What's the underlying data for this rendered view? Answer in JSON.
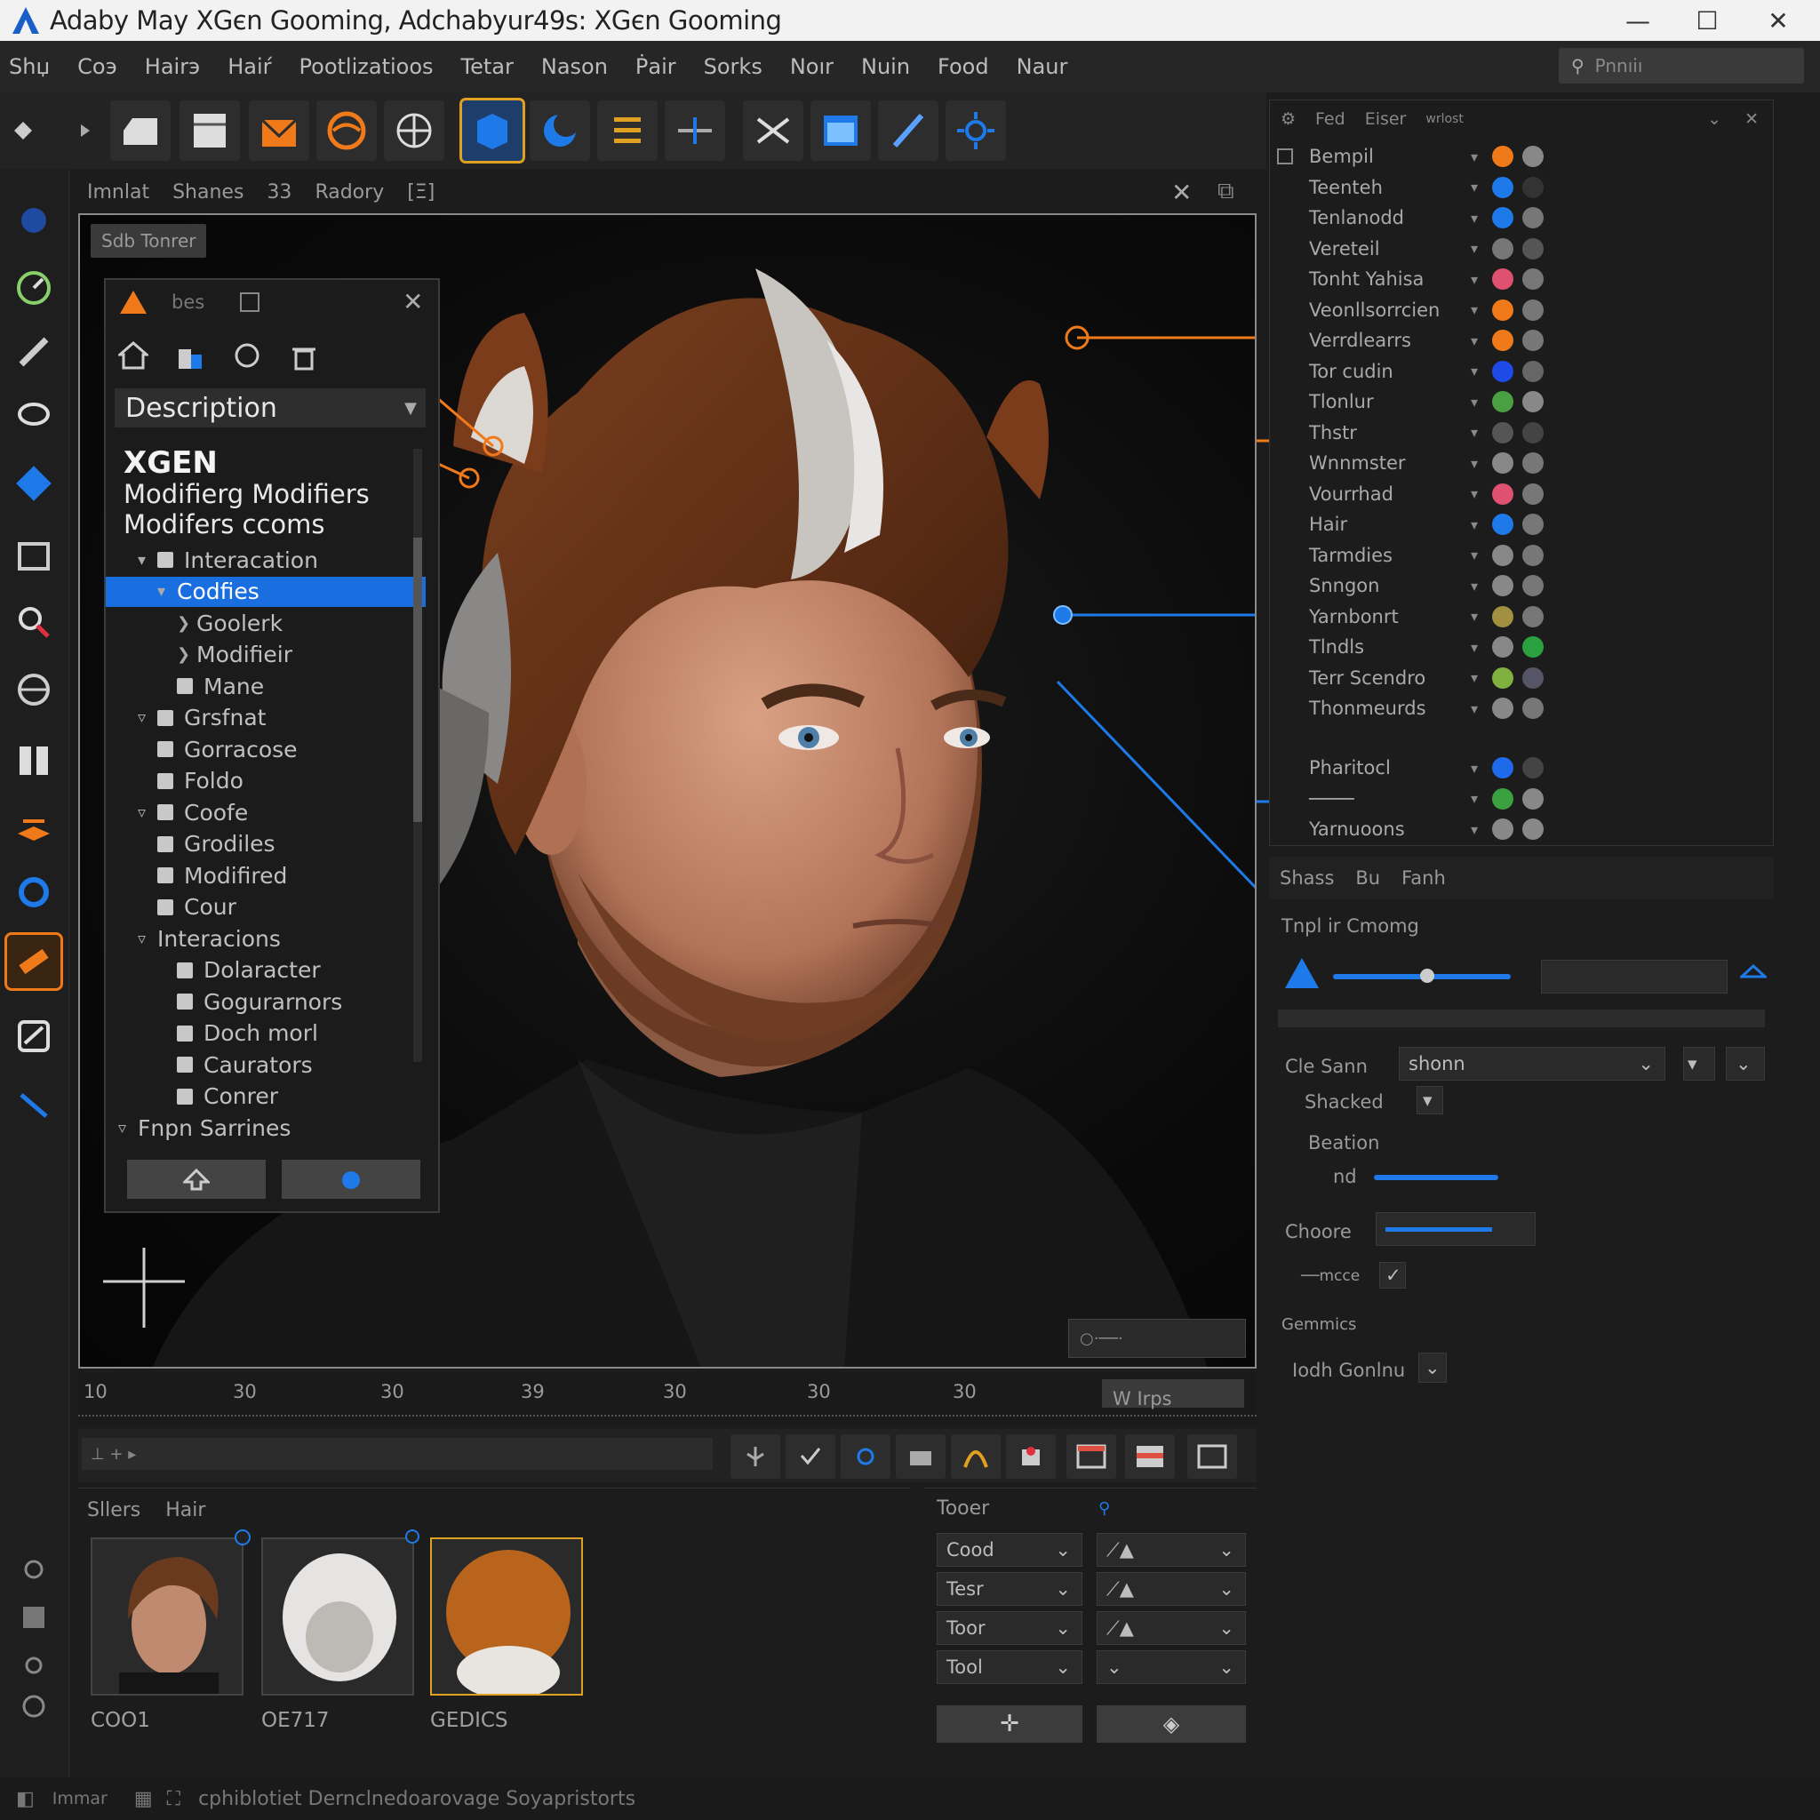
{
  "window": {
    "title": "Adaby May XGєn Goomіng, Adchabyur49s: XGєn Gooming",
    "minimize_glyph": "—",
    "maximize_glyph": "☐",
    "close_glyph": "✕"
  },
  "menu": [
    "Shџ",
    "Coэ",
    "Hairэ",
    "Haiŕ",
    "Pootlizatioos",
    "Tetar",
    "Nason",
    "Ṗair",
    "Sorks",
    "Noır",
    "Nuin",
    "Food",
    "Naur"
  ],
  "search": {
    "placeholder": "Pnnıı̇ı"
  },
  "viewport": {
    "tabs": [
      "Imnlat",
      "Shanes",
      "33",
      "Radory",
      "[Ξ]"
    ],
    "label": "Sdb Tonrer",
    "corner_value": "○·──·"
  },
  "desc_panel": {
    "header_text": "bes",
    "selector": "Description",
    "heading": "XGEN",
    "line1": "Modifierg  Modifiers",
    "line2": "Modifers ccoms",
    "tree": [
      {
        "label": "Interacation",
        "indent": 1,
        "arrow": "▾",
        "check": true
      },
      {
        "label": "Codfies",
        "indent": 2,
        "arrow": "▾",
        "check": false,
        "selected": true
      },
      {
        "label": "Goolerk",
        "indent": 3,
        "arrow": "❯",
        "check": false
      },
      {
        "label": "Modifieir",
        "indent": 3,
        "arrow": "❯",
        "check": false
      },
      {
        "label": "Mane",
        "indent": 2,
        "arrow": "",
        "check": true
      },
      {
        "label": "Grsfnat",
        "indent": 1,
        "arrow": "▿",
        "check": true
      },
      {
        "label": "Gorracose",
        "indent": 1,
        "arrow": "",
        "check": true
      },
      {
        "label": "Foldo",
        "indent": 1,
        "arrow": "",
        "check": true
      },
      {
        "label": "Coofe",
        "indent": 1,
        "arrow": "▿",
        "check": true
      },
      {
        "label": "Grodiles",
        "indent": 1,
        "arrow": "",
        "check": true
      },
      {
        "label": "Modifired",
        "indent": 1,
        "arrow": "",
        "check": true
      },
      {
        "label": "Cour",
        "indent": 1,
        "arrow": "",
        "check": true
      },
      {
        "label": "Interacions",
        "indent": 1,
        "arrow": "▿",
        "check": false
      },
      {
        "label": "Dolaracter",
        "indent": 2,
        "arrow": "",
        "check": true
      },
      {
        "label": "Gogurarnors",
        "indent": 2,
        "arrow": "",
        "check": true
      },
      {
        "label": "Doch morl",
        "indent": 2,
        "arrow": "",
        "check": true
      },
      {
        "label": "Caurators",
        "indent": 2,
        "arrow": "",
        "check": true
      },
      {
        "label": "Conrer",
        "indent": 2,
        "arrow": "",
        "check": true
      },
      {
        "label": "Fnpn Sarrines",
        "indent": 0,
        "arrow": "▿",
        "check": false
      }
    ]
  },
  "outliner": {
    "header": [
      "Fed",
      "Eiser",
      "wrlost"
    ],
    "rows": [
      {
        "name": "Bempil",
        "c1": "#f07a1a",
        "c2": "#888"
      },
      {
        "name": "Teenteh",
        "c1": "#1e7ae8",
        "c2": "#333"
      },
      {
        "name": "Tenlanodd",
        "c1": "#1e7ae8",
        "c2": "#777"
      },
      {
        "name": "Vereteil",
        "c1": "#777",
        "c2": "#555"
      },
      {
        "name": "Tonht Yahisa",
        "c1": "#e05070",
        "c2": "#777"
      },
      {
        "name": "Veonllsorrcien",
        "c1": "#f07a1a",
        "c2": "#777"
      },
      {
        "name": "Verrdlearrs",
        "c1": "#f07a1a",
        "c2": "#777"
      },
      {
        "name": "Tor cudin",
        "c1": "#1e4ae8",
        "c2": "#666"
      },
      {
        "name": "Tlonlur",
        "c1": "#4aa040",
        "c2": "#888"
      },
      {
        "name": "Thstr",
        "c1": "#555",
        "c2": "#444"
      },
      {
        "name": "Wnnmster",
        "c1": "#888",
        "c2": "#777"
      },
      {
        "name": "Vourrhad",
        "c1": "#e05070",
        "c2": "#777"
      },
      {
        "name": "Hair",
        "c1": "#1e7ae8",
        "c2": "#777"
      },
      {
        "name": "Tarmdies",
        "c1": "#888",
        "c2": "#777"
      },
      {
        "name": "Snngon",
        "c1": "#888",
        "c2": "#777"
      },
      {
        "name": "Yarnbonrt",
        "c1": "#a09040",
        "c2": "#777"
      },
      {
        "name": "Tlndls",
        "c1": "#888",
        "c2": "#2aa040"
      },
      {
        "name": "Terr Scendro",
        "c1": "#80b040",
        "c2": "#556"
      },
      {
        "name": "Thonmeurds",
        "c1": "#888",
        "c2": "#777"
      }
    ],
    "row2": [
      {
        "name": "Pharitocl",
        "c1": "#1e6ae8",
        "c2": "#444"
      },
      {
        "name": "────",
        "c1": "#3aa040",
        "c2": "#888"
      },
      {
        "name": "Yarnuoons",
        "c1": "#888",
        "c2": "#888"
      }
    ]
  },
  "attributes": {
    "tabs": [
      "Shass",
      "Bu",
      "Fanh"
    ],
    "section_title": "Tnpl ir Cmomg",
    "row_label": "Cle Sann",
    "row_value": "shonn",
    "stacked": "Shacked",
    "section": "Beation",
    "sl_label": "nd",
    "choose_label": "Choore",
    "chance_label": "──mcce",
    "group_label": "Gemmics",
    "bottom_label": "Iodh Gonlnu",
    "slider1": 0.58,
    "slider2": 0.18
  },
  "timeline": {
    "ticks": [
      "10",
      "30",
      "30",
      "39",
      "30",
      "30",
      "30"
    ],
    "field": "W Irps"
  },
  "shelf": {
    "tabs": [
      "Sllers",
      "Hair"
    ],
    "items": [
      {
        "caption": "COO1",
        "kind": "head"
      },
      {
        "caption": "OE717",
        "kind": "white"
      },
      {
        "caption": "GEDICS",
        "kind": "fur"
      }
    ]
  },
  "toolpanel": {
    "title": "Tooer",
    "left": [
      "Cood",
      "Tesr",
      "Toor",
      "Tool"
    ],
    "right": [
      "",
      "",
      "",
      ""
    ]
  },
  "status": {
    "text": "cphiblotiet Dernclnedoarovage Soyapristorts",
    "left": "Immar"
  },
  "colors": {
    "accent_blue": "#1e7ae8",
    "accent_orange": "#f07a1a",
    "selection": "#1a6fe0"
  }
}
